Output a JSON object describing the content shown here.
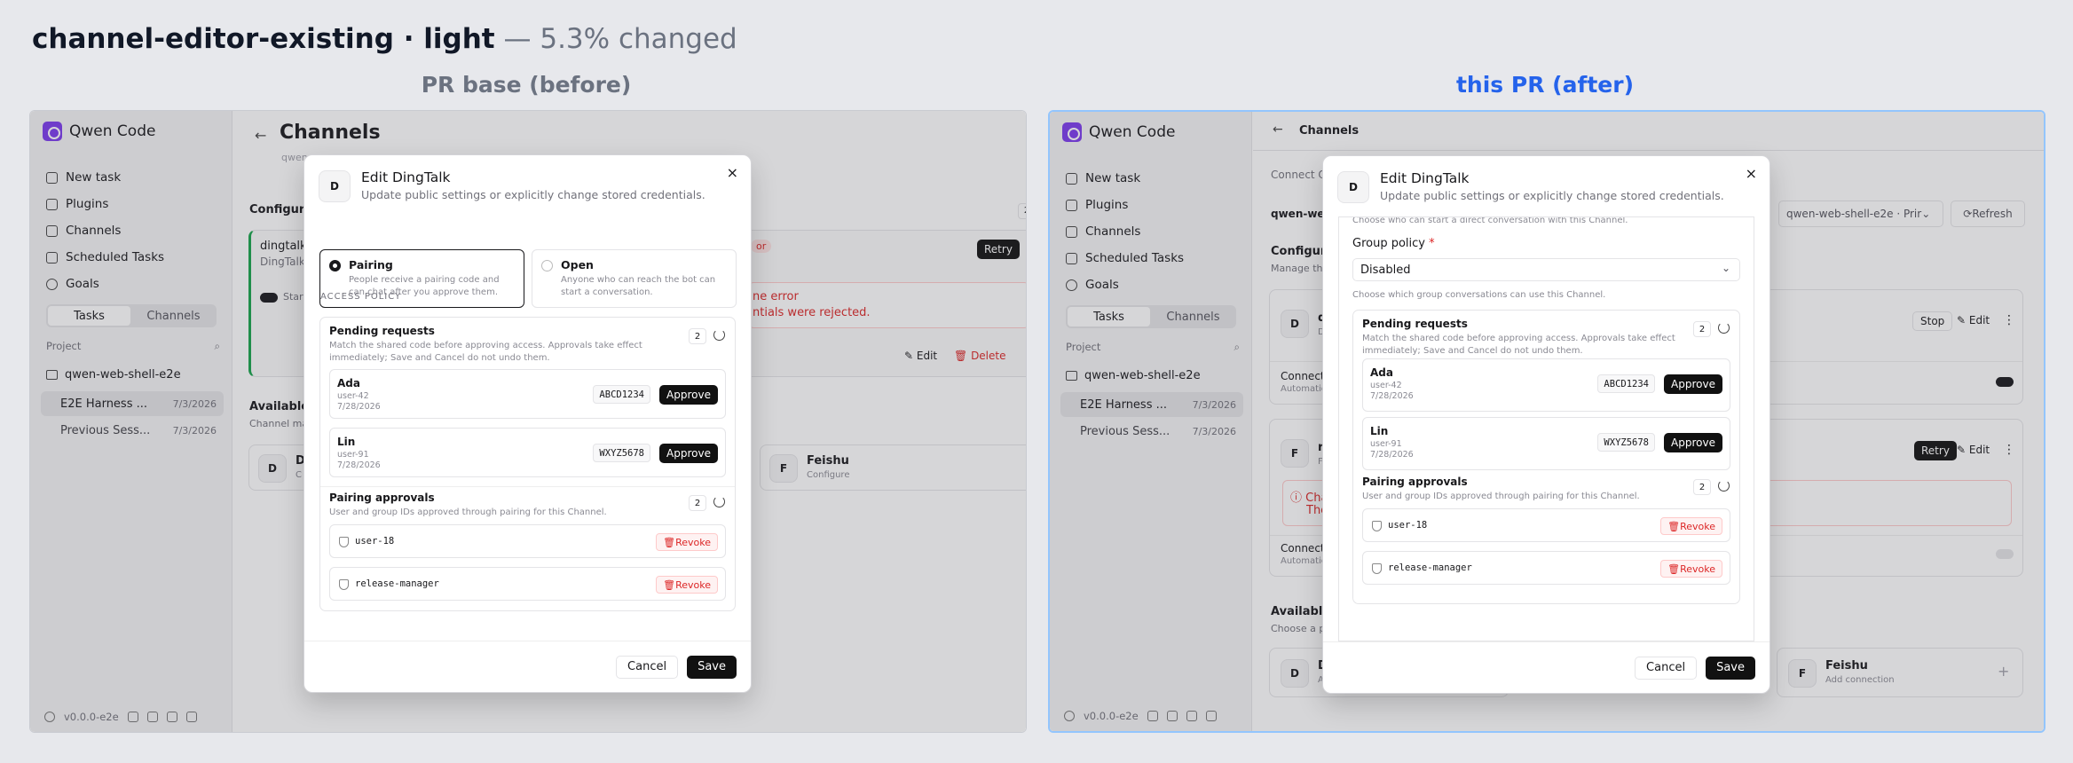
{
  "header": {
    "title": "channel-editor-existing · light",
    "changed": "— 5.3% changed"
  },
  "panels": {
    "before_title": "PR base (before)",
    "after_title": "this PR (after)"
  },
  "colors": {
    "before_title": "#6b7280",
    "after_title": "#2563eb",
    "accent_dark": "#111111",
    "danger": "#dc2626"
  },
  "app": {
    "name": "Qwen Code",
    "nav": [
      "New task",
      "Plugins",
      "Channels",
      "Scheduled Tasks",
      "Goals"
    ],
    "nav_icons": [
      "pencil-icon",
      "puzzle-icon",
      "radio-icon",
      "calendar-icon",
      "target-icon"
    ],
    "segment": [
      "Tasks",
      "Channels"
    ],
    "project_label": "Project",
    "project": "qwen-web-shell-e2e",
    "tasks": [
      {
        "name": "E2E Harness ...",
        "date": "7/3/2026"
      },
      {
        "name": "Previous Sess...",
        "date": "7/3/2026"
      }
    ],
    "version": "v0.0.0-e2e"
  },
  "before_page": {
    "title": "Channels",
    "subtitle": "qwen",
    "configured": "Configure",
    "count": "2",
    "card_name": "dingtalk",
    "card_type": "DingTalk",
    "error_badge": "or",
    "retry": "Retry",
    "start": "Start",
    "error_title": "ne error",
    "error_msg": "ntials were rejected.",
    "edit": "Edit",
    "delete": "Delete",
    "available": "Available",
    "available_sub": "Channel ma",
    "avail_card_letter": "D",
    "avail_card_name": "D",
    "avail_card_sub": "C",
    "feishu_letter": "F",
    "feishu": "Feishu",
    "feishu_sub": "Configure"
  },
  "after_page": {
    "title": "Channels",
    "connect_hint": "Connect Q",
    "workspace_label": "qwen-we",
    "workspace_select": "qwen-web-shell-e2e · Prir",
    "refresh": "Refresh",
    "configured": "Configur",
    "manage": "Manage the",
    "card1_letter": "D",
    "card1_name": "d",
    "card1_sub": "D",
    "stop": "Stop",
    "edit": "Edit",
    "connect": "Connect",
    "automation": "Automatio",
    "card2_letter": "F",
    "card2_name": "r",
    "card2_sub": "F",
    "retry": "Retry",
    "err1": "Cha",
    "err2": "The",
    "available": "Availabl",
    "choose": "Choose a p",
    "avail_letter": "D",
    "avail_name": "D",
    "avail_sub": "A",
    "feishu_letter": "F",
    "feishu": "Feishu",
    "feishu_sub": "Add connection",
    "plus": "+"
  },
  "modal": {
    "avatar": "D",
    "title": "Edit DingTalk",
    "subtitle": "Update public settings or explicitly change stored credentials.",
    "close": "×",
    "access_policy": "ACCESS POLICY",
    "pairing": "Pairing",
    "pairing_desc": "People receive a pairing code and can chat after you approve them.",
    "open": "Open",
    "open_desc": "Anyone who can reach the bot can start a conversation.",
    "cut_text": "Choose who can start a direct conversation with this Channel.",
    "group_policy_label": "Group policy",
    "required": "*",
    "group_policy_value": "Disabled",
    "group_policy_help": "Choose which group conversations can use this Channel.",
    "pending_title": "Pending requests",
    "pending_desc": "Match the shared code before approving access. Approvals take effect immediately; Save and Cancel do not undo them.",
    "pending_count": "2",
    "requests": [
      {
        "name": "Ada",
        "user": "user-42",
        "date": "7/28/2026",
        "code": "ABCD1234",
        "action": "Approve"
      },
      {
        "name": "Lin",
        "user": "user-91",
        "date": "7/28/2026",
        "code": "WXYZ5678",
        "action": "Approve"
      }
    ],
    "approvals_title": "Pairing approvals",
    "approvals_desc": "User and group IDs approved through pairing for this Channel.",
    "approvals_count": "2",
    "approvals": [
      {
        "id": "user-18",
        "action": "Revoke"
      },
      {
        "id": "release-manager",
        "action": "Revoke"
      }
    ],
    "cancel": "Cancel",
    "save": "Save"
  }
}
